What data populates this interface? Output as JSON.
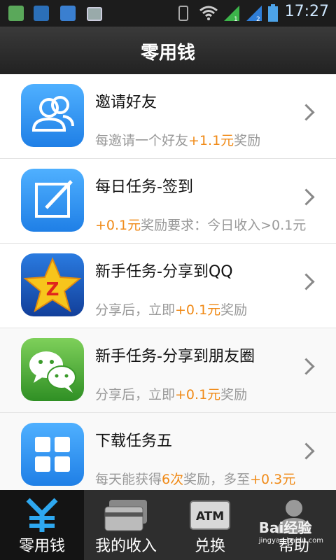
{
  "status_bar": {
    "time": "17:27",
    "left_icons": [
      "app-icon-green",
      "app-icon-blue",
      "app-icon-tasks",
      "image-icon"
    ],
    "right_icons": [
      "vibrate-icon",
      "wifi-icon",
      "signal-1-icon",
      "signal-2-icon",
      "battery-icon"
    ]
  },
  "header": {
    "title": "零用钱"
  },
  "list": [
    {
      "title": "邀请好友",
      "sub_pre": "每邀请一个好友",
      "sub_hl": "+1.1元",
      "sub_post": "奖励",
      "icon": "users-icon",
      "color": "#2f95f3"
    },
    {
      "title": "每日任务-签到",
      "sub_pre": "",
      "sub_hl": "+0.1元",
      "sub_post": "奖励要求：今日收入>0.1元",
      "icon": "edit-icon",
      "color": "#2f95f3"
    },
    {
      "title": "新手任务-分享到QQ",
      "sub_pre": "分享后，立即",
      "sub_hl": "+0.1元",
      "sub_post": "奖励",
      "icon": "qzone-star-icon",
      "color": "#1f5fc5"
    },
    {
      "title": "新手任务-分享到朋友圈",
      "sub_pre": "分享后，立即",
      "sub_hl": "+0.1元",
      "sub_post": "奖励",
      "icon": "wechat-icon",
      "color": "#47b234"
    },
    {
      "title": "下载任务五",
      "sub_pre": "每天能获得",
      "sub_hl": "6次",
      "sub_mid": "奖励，多至",
      "sub_hl2": "+0.3元",
      "icon": "grid-icon",
      "color": "#2f95f3"
    }
  ],
  "tabs": [
    {
      "label": "零用钱",
      "icon": "yen-icon",
      "active": true
    },
    {
      "label": "我的收入",
      "icon": "cards-icon",
      "active": false
    },
    {
      "label": "兑换",
      "icon": "atm-icon",
      "icon_text": "ATM",
      "active": false
    },
    {
      "label": "帮助",
      "icon": "user-silhouette-icon",
      "active": false
    }
  ],
  "watermark": {
    "text": "Bai经验",
    "sub": "jingyan.baidu.com"
  },
  "colors": {
    "accent": "#f08a17",
    "header_bg": "#2a2a2a",
    "tab_bar_bg": "#2e2e2e"
  }
}
